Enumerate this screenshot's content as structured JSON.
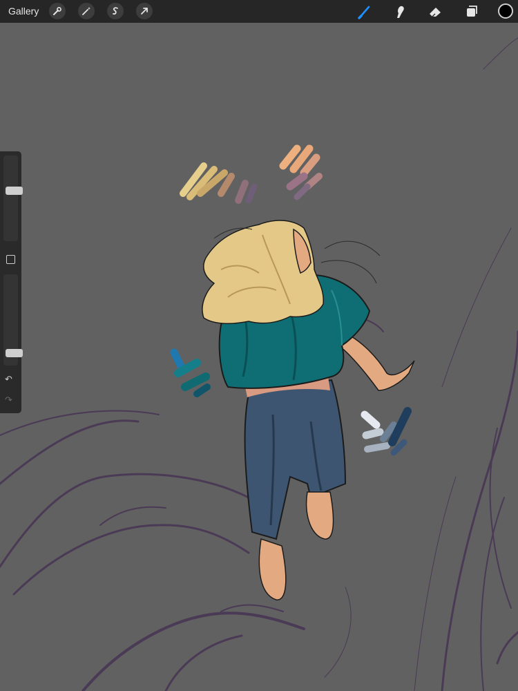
{
  "topbar": {
    "gallery_label": "Gallery",
    "left_tools": [
      "wrench-icon",
      "magic-wand-icon",
      "selection-icon",
      "transform-arrow-icon"
    ],
    "right_tools": [
      "brush-icon",
      "smudge-icon",
      "eraser-icon",
      "layers-icon"
    ],
    "active_tool": "brush-icon",
    "active_color": "#000000"
  },
  "sidebar": {
    "brush_size_level": 0.6,
    "opacity_level": 0.1,
    "undo_icon": "undo-icon",
    "redo_icon": "redo-icon"
  },
  "colors": {
    "canvas_bg": "#616161",
    "toolbar_bg": "#262626",
    "accent": "#1e90ff",
    "hair": "#e3c887",
    "shirt": "#0f6e73",
    "pants": "#3d5570",
    "skin": "#e3a980",
    "sketch_lines": "#4a3a55"
  }
}
